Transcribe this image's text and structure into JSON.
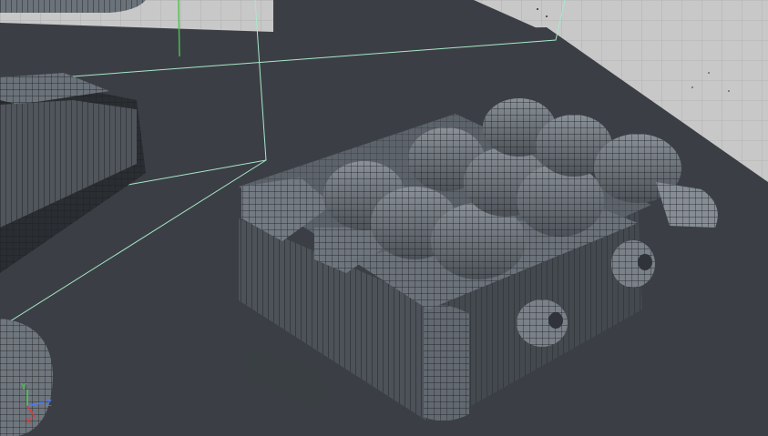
{
  "viewport": {
    "background_color": "#3b3f45",
    "grid_plane_color": "#c9c9c9",
    "grid_line_color": "#a9a9a9",
    "selection_frame_color": "#a8e8c8",
    "mesh_fill_color": "#6b727a",
    "mesh_wire_color": "#141618",
    "axis_y_color": "#4cc24c"
  },
  "axis_gizmo": {
    "y_label": "Y",
    "z_label": "Z",
    "x_label": "X",
    "y_color": "#4cd24c",
    "z_color": "#4c7cff",
    "x_color": "#e23a3a"
  }
}
